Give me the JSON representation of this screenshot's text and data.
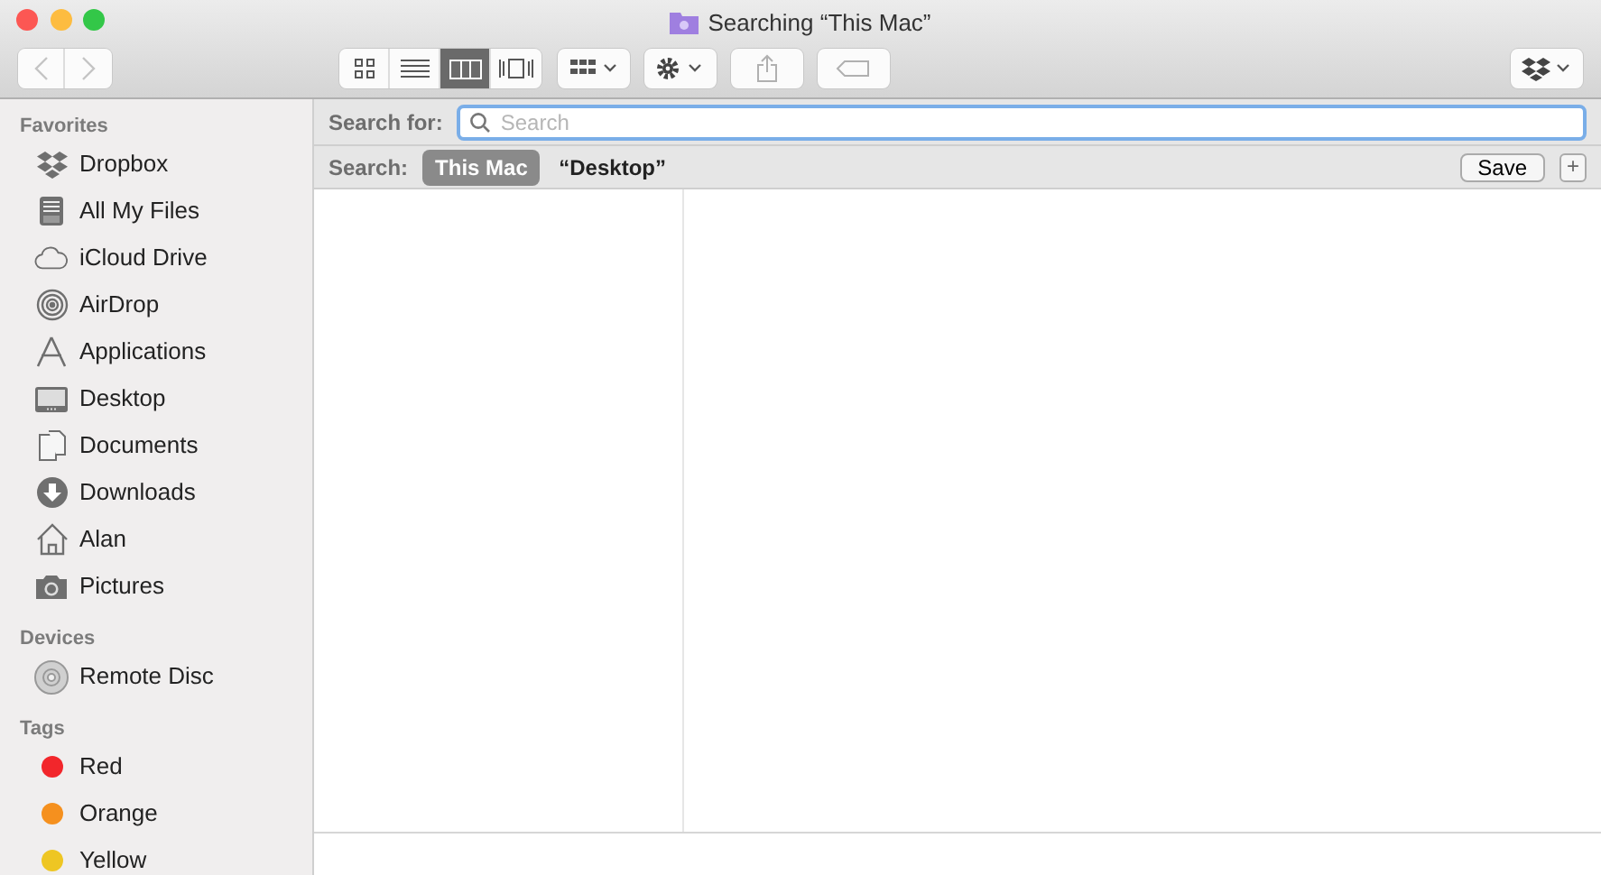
{
  "window": {
    "title": "Searching “This Mac”"
  },
  "toolbar": {
    "view_modes": [
      {
        "kind": "icons",
        "selected": false
      },
      {
        "kind": "list",
        "selected": false
      },
      {
        "kind": "columns",
        "selected": true
      },
      {
        "kind": "coverflow",
        "selected": false
      }
    ]
  },
  "sidebar": {
    "sections": [
      {
        "heading": "Favorites",
        "items": [
          {
            "label": "Dropbox",
            "kind": "dropbox"
          },
          {
            "label": "All My Files",
            "kind": "files"
          },
          {
            "label": "iCloud Drive",
            "kind": "cloud"
          },
          {
            "label": "AirDrop",
            "kind": "airdrop"
          },
          {
            "label": "Applications",
            "kind": "apps"
          },
          {
            "label": "Desktop",
            "kind": "desktop"
          },
          {
            "label": "Documents",
            "kind": "documents"
          },
          {
            "label": "Downloads",
            "kind": "downloads"
          },
          {
            "label": "Alan",
            "kind": "home"
          },
          {
            "label": "Pictures",
            "kind": "camera"
          }
        ]
      },
      {
        "heading": "Devices",
        "items": [
          {
            "label": "Remote Disc",
            "kind": "disc"
          }
        ]
      },
      {
        "heading": "Tags",
        "items": [
          {
            "label": "Red",
            "kind": "tag",
            "color": "#f2262b"
          },
          {
            "label": "Orange",
            "kind": "tag",
            "color": "#f5901e"
          },
          {
            "label": "Yellow",
            "kind": "tag",
            "color": "#eec623"
          }
        ]
      }
    ]
  },
  "search": {
    "label": "Search for:",
    "placeholder": "Search"
  },
  "scope": {
    "label": "Search:",
    "options": [
      {
        "label": "This Mac",
        "selected": true
      },
      {
        "label": "“Desktop”",
        "selected": false
      }
    ],
    "save": "Save",
    "add": "+"
  }
}
